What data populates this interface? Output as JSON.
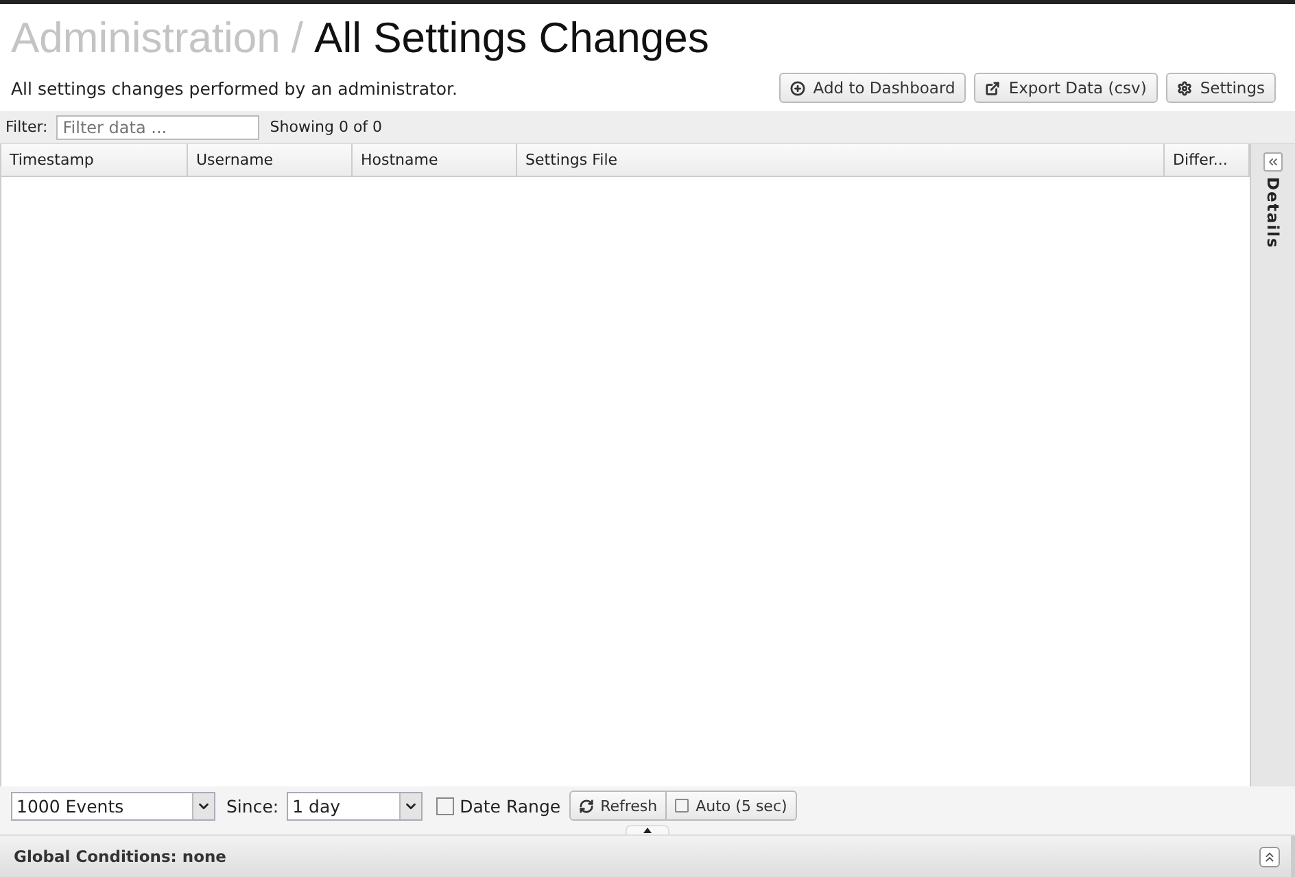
{
  "breadcrumb": {
    "parent": "Administration",
    "separator": "/",
    "current": "All Settings Changes"
  },
  "description": "All settings changes performed by an administrator.",
  "actions": [
    {
      "kind": "dashboard",
      "label": "Add to Dashboard"
    },
    {
      "kind": "export",
      "label": "Export Data (csv)"
    },
    {
      "kind": "settings",
      "label": "Settings"
    }
  ],
  "filter": {
    "label": "Filter:",
    "placeholder": "Filter data ...",
    "count": "Showing 0 of 0"
  },
  "table": {
    "columns": [
      "Timestamp",
      "Username",
      "Hostname",
      "Settings File",
      "Differ..."
    ]
  },
  "details_panel": {
    "title": "Details",
    "expanded": false
  },
  "toolbar": {
    "events": "1000 Events",
    "since_label": "Since:",
    "since": "1 day",
    "date_range": {
      "label": "Date Range",
      "checked": false
    },
    "refresh": "Refresh",
    "auto": {
      "label": "Auto (5 sec)",
      "checked": false
    }
  },
  "global_conditions": {
    "text": "Global Conditions: none",
    "expanded": false
  }
}
